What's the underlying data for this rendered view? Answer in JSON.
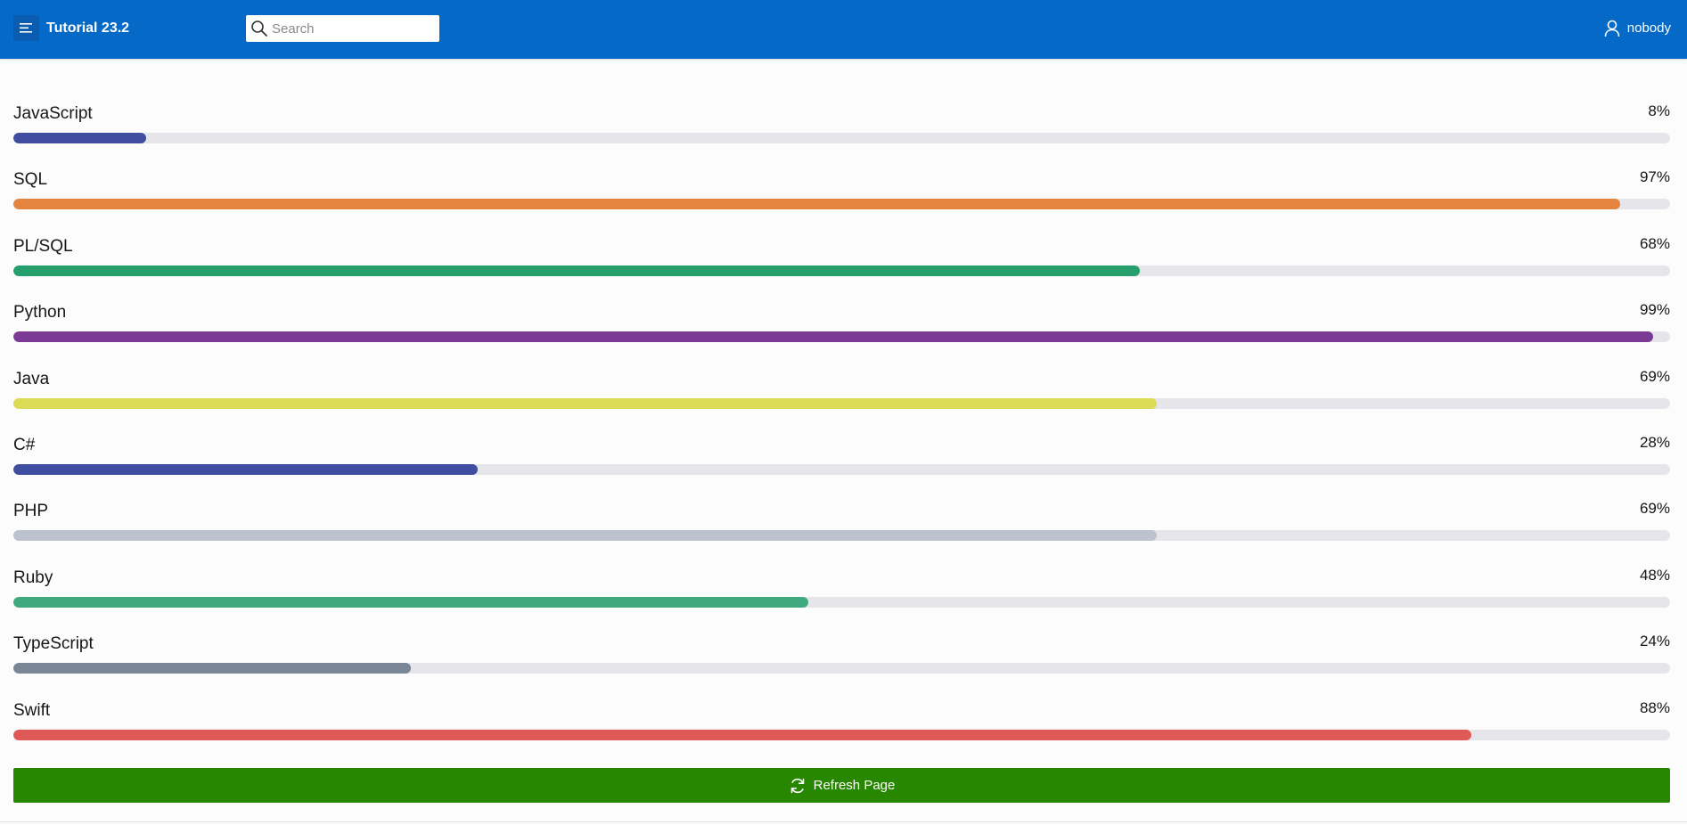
{
  "header": {
    "app_title": "Tutorial 23.2",
    "search_placeholder": "Search",
    "user_name": "nobody",
    "background_color": "#0569c8"
  },
  "skills": [
    {
      "label": "JavaScript",
      "value_text": "8%",
      "value": 8,
      "color": "#3f4ea0"
    },
    {
      "label": "SQL",
      "value_text": "97%",
      "value": 97,
      "color": "#e5843f"
    },
    {
      "label": "PL/SQL",
      "value_text": "68%",
      "value": 68,
      "color": "#25a06c"
    },
    {
      "label": "Python",
      "value_text": "99%",
      "value": 99,
      "color": "#7b3a94"
    },
    {
      "label": "Java",
      "value_text": "69%",
      "value": 69,
      "color": "#dcdb55"
    },
    {
      "label": "C#",
      "value_text": "28%",
      "value": 28,
      "color": "#3f4ea0"
    },
    {
      "label": "PHP",
      "value_text": "69%",
      "value": 69,
      "color": "#bcc3ce"
    },
    {
      "label": "Ruby",
      "value_text": "48%",
      "value": 48,
      "color": "#3faa7e"
    },
    {
      "label": "TypeScript",
      "value_text": "24%",
      "value": 24,
      "color": "#788696"
    },
    {
      "label": "Swift",
      "value_text": "88%",
      "value": 88,
      "color": "#df5a57"
    }
  ],
  "refresh_button": {
    "label": "Refresh Page",
    "color": "#288700"
  }
}
